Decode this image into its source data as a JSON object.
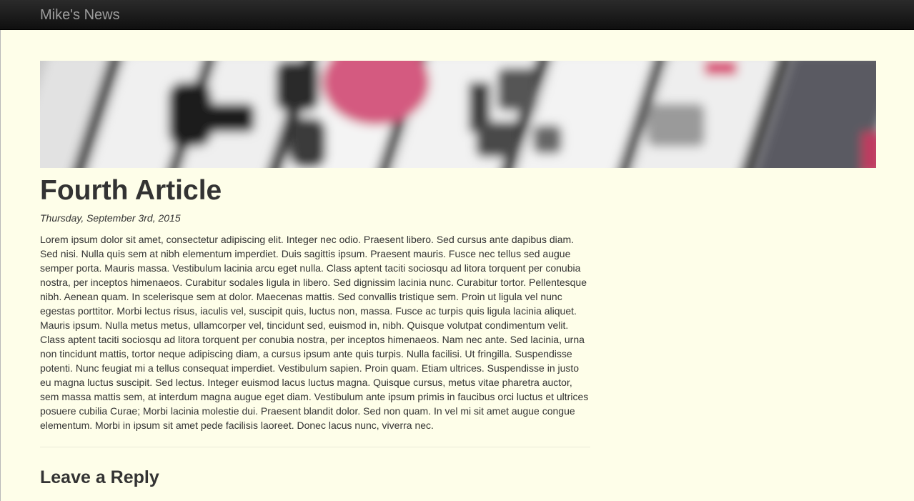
{
  "navbar": {
    "brand": "Mike's News"
  },
  "article": {
    "title": "Fourth Article",
    "date": "Thursday, September 3rd, 2015",
    "body": "Lorem ipsum dolor sit amet, consectetur adipiscing elit. Integer nec odio. Praesent libero. Sed cursus ante dapibus diam. Sed nisi. Nulla quis sem at nibh elementum imperdiet. Duis sagittis ipsum. Praesent mauris. Fusce nec tellus sed augue semper porta. Mauris massa. Vestibulum lacinia arcu eget nulla. Class aptent taciti sociosqu ad litora torquent per conubia nostra, per inceptos himenaeos. Curabitur sodales ligula in libero. Sed dignissim lacinia nunc. Curabitur tortor. Pellentesque nibh. Aenean quam. In scelerisque sem at dolor. Maecenas mattis. Sed convallis tristique sem. Proin ut ligula vel nunc egestas porttitor. Morbi lectus risus, iaculis vel, suscipit quis, luctus non, massa. Fusce ac turpis quis ligula lacinia aliquet. Mauris ipsum. Nulla metus metus, ullamcorper vel, tincidunt sed, euismod in, nibh. Quisque volutpat condimentum velit. Class aptent taciti sociosqu ad litora torquent per conubia nostra, per inceptos himenaeos. Nam nec ante. Sed lacinia, urna non tincidunt mattis, tortor neque adipiscing diam, a cursus ipsum ante quis turpis. Nulla facilisi. Ut fringilla. Suspendisse potenti. Nunc feugiat mi a tellus consequat imperdiet. Vestibulum sapien. Proin quam. Etiam ultrices. Suspendisse in justo eu magna luctus suscipit. Sed lectus. Integer euismod lacus luctus magna. Quisque cursus, metus vitae pharetra auctor, sem massa mattis sem, at interdum magna augue eget diam. Vestibulum ante ipsum primis in faucibus orci luctus et ultrices posuere cubilia Curae; Morbi lacinia molestie dui. Praesent blandit dolor. Sed non quam. In vel mi sit amet augue congue elementum. Morbi in ipsum sit amet pede facilisis laoreet. Donec lacus nunc, viverra nec."
  },
  "reply": {
    "heading": "Leave a Reply"
  },
  "colors": {
    "page_background": "#fefee9",
    "navbar_background": "#1a1a1a",
    "brand_text": "#9d9d9d",
    "body_text": "#333333",
    "banner_accent": "#d9416f"
  }
}
